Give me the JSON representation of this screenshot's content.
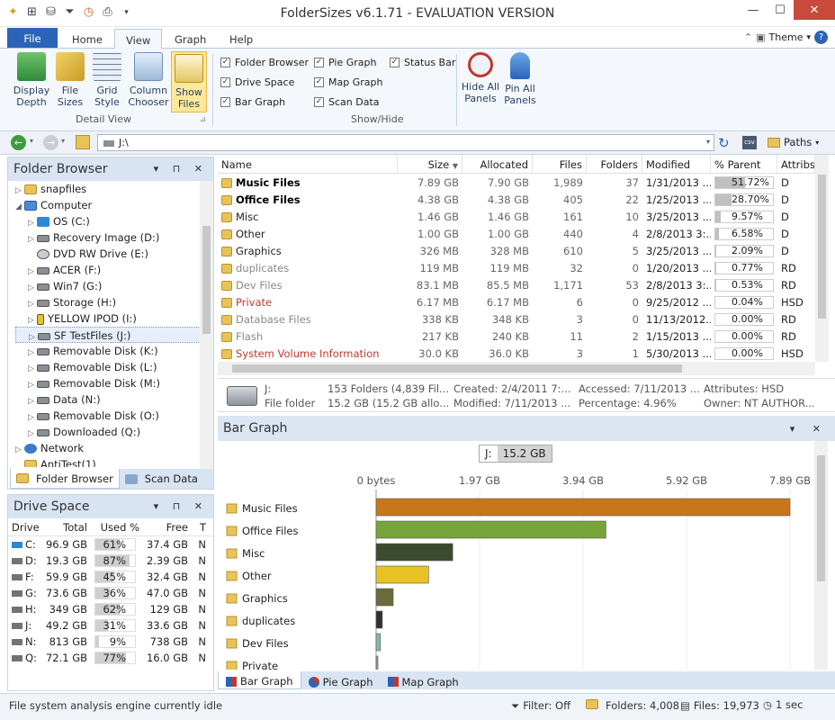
{
  "title": "FolderSizes v6.1.71 - EVALUATION VERSION",
  "tabs": {
    "file": "File",
    "home": "Home",
    "view": "View",
    "graph": "Graph",
    "help": "Help",
    "theme": "Theme"
  },
  "ribbon": {
    "display_depth": "Display Depth",
    "file_sizes": "File Sizes",
    "grid_style": "Grid Style",
    "column_chooser": "Column Chooser",
    "show_files": "Show Files",
    "detail_view": "Detail View",
    "show_hide": "Show/Hide",
    "checks": {
      "folder_browser": "Folder Browser",
      "drive_space": "Drive Space",
      "bar_graph": "Bar Graph",
      "pie_graph": "Pie Graph",
      "map_graph": "Map Graph",
      "scan_data": "Scan Data",
      "status_bar": "Status Bar"
    },
    "hide_all": "Hide All Panels",
    "pin_all": "Pin All Panels"
  },
  "address": {
    "path": "J:\\",
    "paths": "Paths"
  },
  "folder_browser": {
    "title": "Folder Browser",
    "items": [
      {
        "label": "snapfiles",
        "indent": 0,
        "icon": "folder",
        "arrow": "▷"
      },
      {
        "label": "Computer",
        "indent": 0,
        "icon": "computer",
        "arrow": "◢"
      },
      {
        "label": "OS (C:)",
        "indent": 1,
        "icon": "windows",
        "arrow": "▷"
      },
      {
        "label": "Recovery Image (D:)",
        "indent": 1,
        "icon": "drive",
        "arrow": "▷"
      },
      {
        "label": "DVD RW Drive (E:)",
        "indent": 1,
        "icon": "disc",
        "arrow": ""
      },
      {
        "label": "ACER (F:)",
        "indent": 1,
        "icon": "drive",
        "arrow": "▷"
      },
      {
        "label": "Win7 (G:)",
        "indent": 1,
        "icon": "drive",
        "arrow": "▷"
      },
      {
        "label": "Storage (H:)",
        "indent": 1,
        "icon": "drive",
        "arrow": "▷"
      },
      {
        "label": "YELLOW IPOD (I:)",
        "indent": 1,
        "icon": "ipod",
        "arrow": "▷"
      },
      {
        "label": "SF TestFiles (J:)",
        "indent": 1,
        "icon": "drive",
        "arrow": "▷"
      },
      {
        "label": "Removable Disk (K:)",
        "indent": 1,
        "icon": "usb",
        "arrow": "▷"
      },
      {
        "label": "Removable Disk (L:)",
        "indent": 1,
        "icon": "usb",
        "arrow": "▷"
      },
      {
        "label": "Removable Disk (M:)",
        "indent": 1,
        "icon": "usb",
        "arrow": "▷"
      },
      {
        "label": "Data (N:)",
        "indent": 1,
        "icon": "net",
        "arrow": "▷"
      },
      {
        "label": "Removable Disk (O:)",
        "indent": 1,
        "icon": "usb",
        "arrow": "▷"
      },
      {
        "label": "Downloaded (Q:)",
        "indent": 1,
        "icon": "drive",
        "arrow": "▷"
      },
      {
        "label": "Network",
        "indent": 0,
        "icon": "network",
        "arrow": "▷"
      },
      {
        "label": "AntiTest(1)",
        "indent": 0,
        "icon": "folder",
        "arrow": ""
      }
    ],
    "tab_folder": "Folder Browser",
    "tab_scan": "Scan Data"
  },
  "drive_space": {
    "title": "Drive Space",
    "headers": [
      "Drive",
      "Total",
      "Used %",
      "Free",
      "T"
    ],
    "rows": [
      {
        "drive": "C:",
        "total": "96.9 GB",
        "used": "61%",
        "pct": 61,
        "free": "37.4 GB",
        "t": "N"
      },
      {
        "drive": "D:",
        "total": "19.3 GB",
        "used": "87%",
        "pct": 87,
        "free": "2.39 GB",
        "t": "N"
      },
      {
        "drive": "F:",
        "total": "59.9 GB",
        "used": "45%",
        "pct": 45,
        "free": "32.4 GB",
        "t": "N"
      },
      {
        "drive": "G:",
        "total": "73.6 GB",
        "used": "36%",
        "pct": 36,
        "free": "47.0 GB",
        "t": "N"
      },
      {
        "drive": "H:",
        "total": "349 GB",
        "used": "62%",
        "pct": 62,
        "free": "129 GB",
        "t": "N"
      },
      {
        "drive": "J:",
        "total": "49.2 GB",
        "used": "31%",
        "pct": 31,
        "free": "33.6 GB",
        "t": "N"
      },
      {
        "drive": "N:",
        "total": "813 GB",
        "used": "9%",
        "pct": 9,
        "free": "738 GB",
        "t": "N"
      },
      {
        "drive": "Q:",
        "total": "72.1 GB",
        "used": "77%",
        "pct": 77,
        "free": "16.0 GB",
        "t": "N"
      }
    ]
  },
  "grid": {
    "headers": {
      "name": "Name",
      "size": "Size",
      "alloc": "Allocated",
      "files": "Files",
      "folders": "Folders",
      "modified": "Modified",
      "pct": "% Parent",
      "attr": "Attribs"
    },
    "rows": [
      {
        "name": "Music Files",
        "size": "7.89 GB",
        "alloc": "7.90 GB",
        "files": "1,989",
        "folders": "37",
        "mod": "1/31/2013 ...",
        "pct": "51.72%",
        "pv": 51.72,
        "attr": "D",
        "style": "bold"
      },
      {
        "name": "Office Files",
        "size": "4.38 GB",
        "alloc": "4.38 GB",
        "files": "405",
        "folders": "22",
        "mod": "1/25/2013 ...",
        "pct": "28.70%",
        "pv": 28.7,
        "attr": "D",
        "style": "bold"
      },
      {
        "name": "Misc",
        "size": "1.46 GB",
        "alloc": "1.46 GB",
        "files": "161",
        "folders": "10",
        "mod": "3/25/2013 ...",
        "pct": "9.57%",
        "pv": 9.57,
        "attr": "D",
        "style": "normal"
      },
      {
        "name": "Other",
        "size": "1.00 GB",
        "alloc": "1.00 GB",
        "files": "440",
        "folders": "4",
        "mod": "2/8/2013 3:...",
        "pct": "6.58%",
        "pv": 6.58,
        "attr": "D",
        "style": "normal"
      },
      {
        "name": "Graphics",
        "size": "326 MB",
        "alloc": "328 MB",
        "files": "610",
        "folders": "5",
        "mod": "3/25/2013 ...",
        "pct": "2.09%",
        "pv": 2.09,
        "attr": "D",
        "style": "normal"
      },
      {
        "name": "duplicates",
        "size": "119 MB",
        "alloc": "119 MB",
        "files": "32",
        "folders": "0",
        "mod": "1/20/2013 ...",
        "pct": "0.77%",
        "pv": 0.77,
        "attr": "RD",
        "style": "gray"
      },
      {
        "name": "Dev Files",
        "size": "83.1 MB",
        "alloc": "85.5 MB",
        "files": "1,171",
        "folders": "53",
        "mod": "2/8/2013 3:...",
        "pct": "0.53%",
        "pv": 0.53,
        "attr": "RD",
        "style": "gray"
      },
      {
        "name": "Private",
        "size": "6.17 MB",
        "alloc": "6.17 MB",
        "files": "6",
        "folders": "0",
        "mod": "9/25/2012 ...",
        "pct": "0.04%",
        "pv": 0.04,
        "attr": "HSD",
        "style": "red"
      },
      {
        "name": "Database Files",
        "size": "338 KB",
        "alloc": "348 KB",
        "files": "3",
        "folders": "0",
        "mod": "11/13/2012...",
        "pct": "0.00%",
        "pv": 0,
        "attr": "RD",
        "style": "gray"
      },
      {
        "name": "Flash",
        "size": "217 KB",
        "alloc": "240 KB",
        "files": "11",
        "folders": "2",
        "mod": "1/15/2013 ...",
        "pct": "0.00%",
        "pv": 0,
        "attr": "RD",
        "style": "gray"
      },
      {
        "name": "System Volume Information",
        "size": "30.0 KB",
        "alloc": "36.0 KB",
        "files": "3",
        "folders": "1",
        "mod": "5/30/2013 ...",
        "pct": "0.00%",
        "pv": 0,
        "attr": "HSD",
        "style": "red"
      }
    ]
  },
  "summary": {
    "drive": "J:",
    "type": "File folder",
    "count": "153 Folders (4,839 Fil...",
    "size": "15.2 GB (15.2 GB allo...",
    "created": "Created: 2/4/2011 7:...",
    "modified": "Modified: 7/11/2013 ...",
    "accessed": "Accessed: 7/11/2013 ...",
    "percentage": "Percentage: 4.96%",
    "attributes": "Attributes: HSD",
    "owner": "Owner: NT AUTHOR..."
  },
  "bar_graph": {
    "title": "Bar Graph",
    "drive_label": "J:",
    "drive_size": "15.2 GB",
    "tab_bar": "Bar Graph",
    "tab_pie": "Pie Graph",
    "tab_map": "Map Graph"
  },
  "chart_data": {
    "type": "bar",
    "orientation": "horizontal",
    "ticks": [
      "0 bytes",
      "1.97 GB",
      "3.94 GB",
      "5.92 GB",
      "7.89 GB"
    ],
    "xlim": [
      0,
      7.89
    ],
    "unit": "GB",
    "categories": [
      "Music Files",
      "Office Files",
      "Misc",
      "Other",
      "Graphics",
      "duplicates",
      "Dev Files",
      "Private"
    ],
    "values": [
      7.89,
      4.38,
      1.46,
      1.0,
      0.326,
      0.119,
      0.083,
      0.006
    ],
    "colors": [
      "#c9761a",
      "#77a33b",
      "#3c4a2e",
      "#e8c225",
      "#6c6a3a",
      "#2f3030",
      "#89b8a8",
      "#999999"
    ]
  },
  "status": {
    "left": "File system analysis engine currently idle",
    "filter": "Filter: Off",
    "folders": "Folders: 4,008",
    "files": "Files: 19,973",
    "time": "1 sec"
  }
}
